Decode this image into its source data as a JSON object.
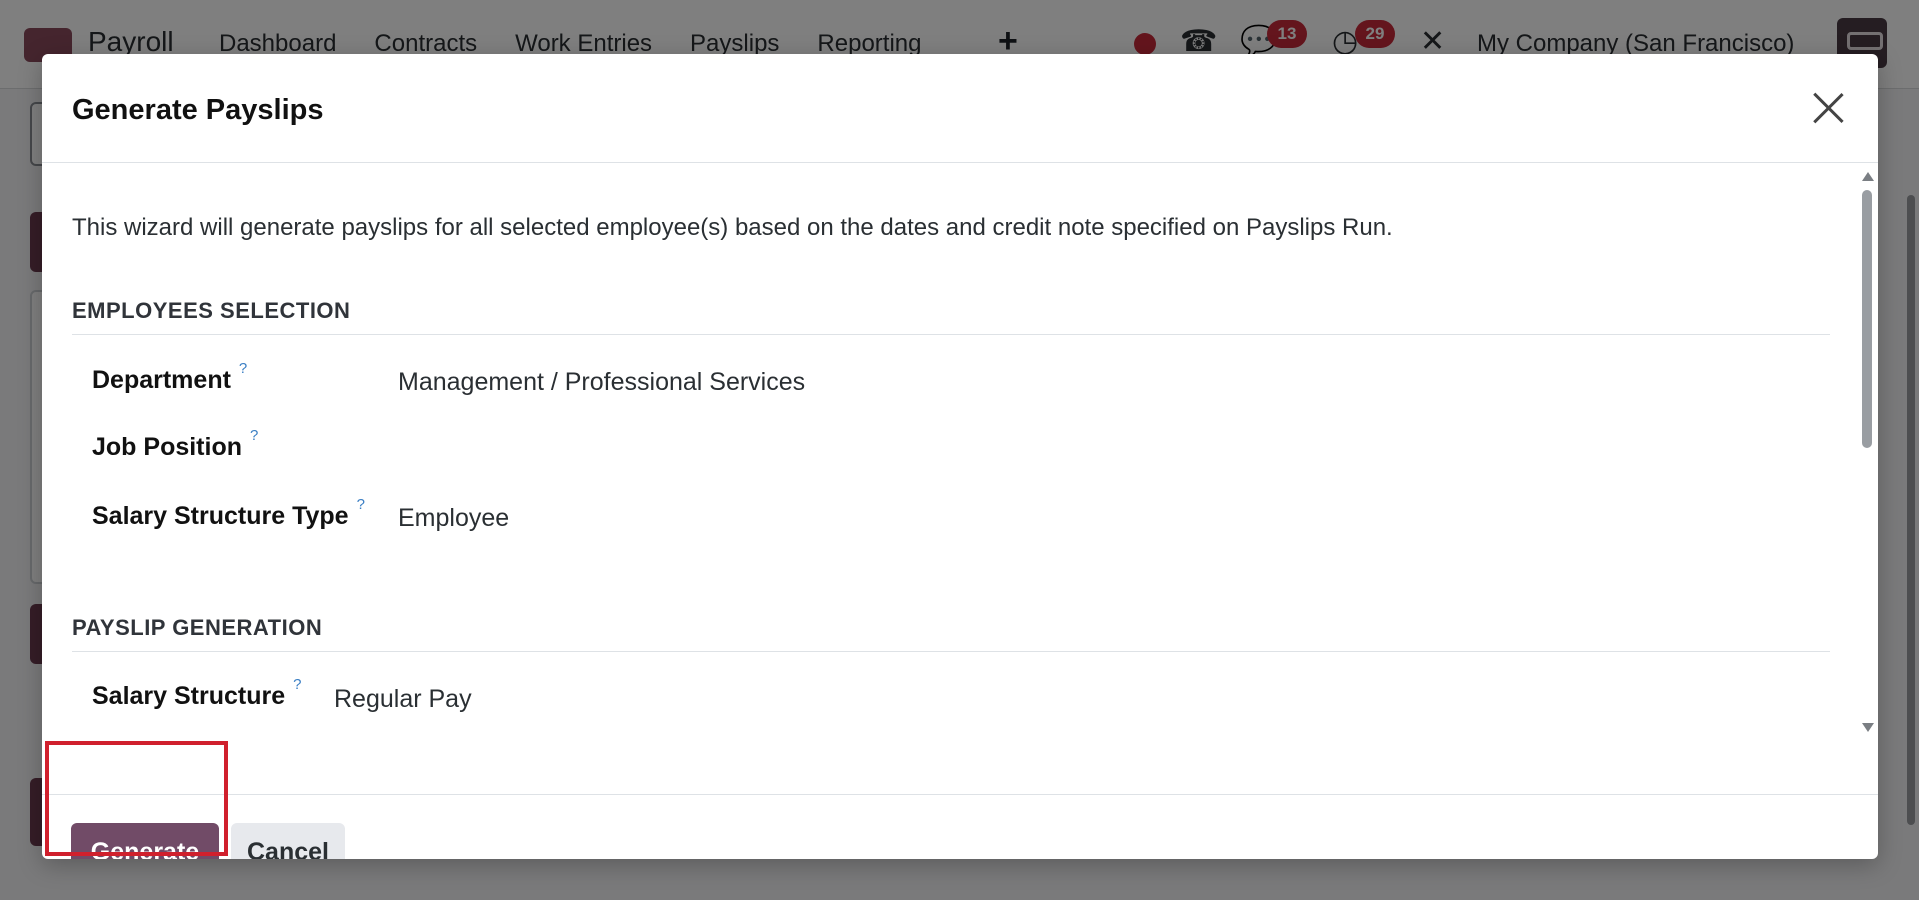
{
  "navbar": {
    "app_name": "Payroll",
    "menu": [
      "Dashboard",
      "Contracts",
      "Work Entries",
      "Payslips",
      "Reporting"
    ],
    "plus_symbol": "+",
    "messages_count": "13",
    "activities_count": "29",
    "company": "My Company (San Francisco)"
  },
  "modal": {
    "title": "Generate Payslips",
    "intro": "This wizard will generate payslips for all selected employee(s) based on the dates and credit note specified on Payslips Run.",
    "help_mark": "?",
    "employees_section": {
      "title": "EMPLOYEES SELECTION",
      "department_label": "Department",
      "department_value": "Management / Professional Services",
      "job_position_label": "Job Position",
      "job_position_value": "",
      "structure_type_label": "Salary Structure Type",
      "structure_type_value": "Employee"
    },
    "generation_section": {
      "title": "PAYSLIP GENERATION",
      "salary_structure_label": "Salary Structure",
      "salary_structure_value": "Regular Pay"
    },
    "footer": {
      "generate_label": "Generate",
      "cancel_label": "Cancel"
    }
  },
  "colors": {
    "primary": "#714b67",
    "highlight": "#d0202d",
    "badge": "#c92a3a"
  }
}
